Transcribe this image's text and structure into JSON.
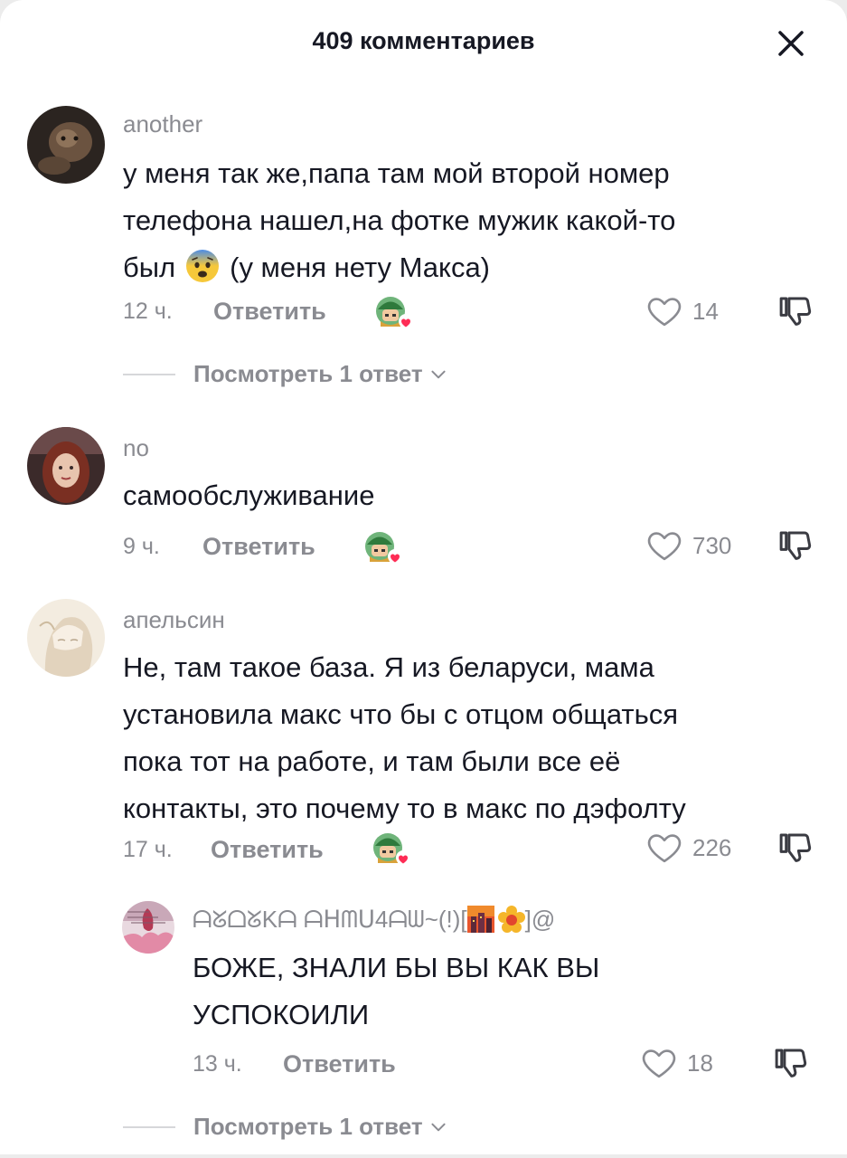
{
  "header": {
    "title": "409 комментариев"
  },
  "comments": [
    {
      "username": "another",
      "text_line1": "у меня так же,папа там мой второй номер",
      "text_line2": "телефона нашел,на фотке мужик какой-то",
      "text_line3_a": "был",
      "text_line3_b": "(у меня нету Макса)",
      "time": "12 ч.",
      "reply_label": "Ответить",
      "likes": "14",
      "view_replies": "Посмотреть 1 ответ"
    },
    {
      "username": "no",
      "text_line1": "самообслуживание",
      "time": "9 ч.",
      "reply_label": "Ответить",
      "likes": "730"
    },
    {
      "username": "апельсин",
      "text_line1": "Не, там такое база. Я из беларуси, мама",
      "text_line2": "установила макс что бы с отцом общаться",
      "text_line3": "пока тот на работе, и там были все её",
      "text_line4": "контакты, это почему то в макс по дэфолту",
      "time": "17 ч.",
      "reply_label": "Ответить",
      "likes": "226",
      "reply": {
        "username_a": "ᗩᘜᗝᘜKᗩ ᗩᕼᗰᑌ4ᗩᗯ~(!)[",
        "username_b": "]@",
        "text_line1": "БОЖЕ, ЗНАЛИ БЫ ВЫ КАК ВЫ",
        "text_line2": "УСПОКОИЛИ",
        "time": "13 ч.",
        "reply_label": "Ответить",
        "likes": "18"
      },
      "view_replies": "Посмотреть 1 ответ"
    }
  ],
  "colors": {
    "muted": "#8a8b91",
    "text": "#161823",
    "heart_badge": "#fe2c55"
  }
}
